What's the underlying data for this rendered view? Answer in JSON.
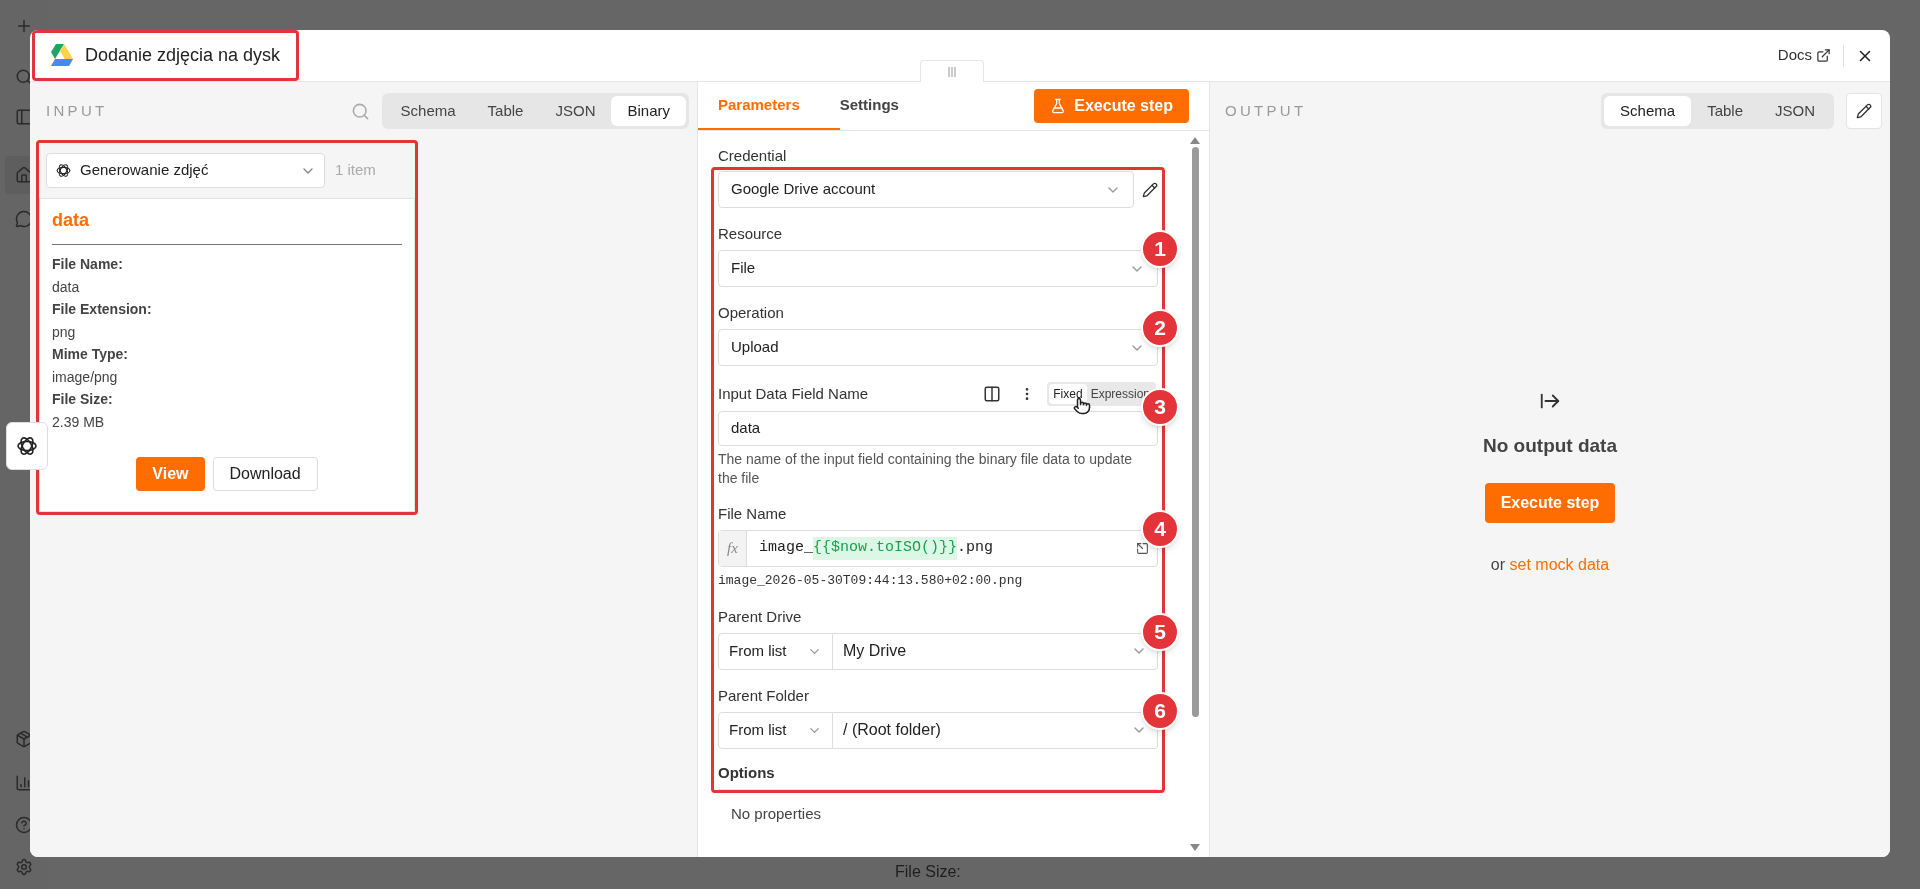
{
  "dialog": {
    "title": "Dodanie zdjęcia na dysk",
    "docs_link": "Docs"
  },
  "input_panel": {
    "heading": "INPUT",
    "tabs": [
      {
        "label": "Schema",
        "selected": false
      },
      {
        "label": "Table",
        "selected": false
      },
      {
        "label": "JSON",
        "selected": false
      },
      {
        "label": "Binary",
        "selected": true
      }
    ],
    "source": {
      "value": "Generowanie zdjęć",
      "count": "1 item"
    },
    "binary_card": {
      "title": "data",
      "fields": [
        {
          "label": "File Name:",
          "value": "data"
        },
        {
          "label": "File Extension:",
          "value": "png"
        },
        {
          "label": "Mime Type:",
          "value": "image/png"
        },
        {
          "label": "File Size:",
          "value": "2.39 MB"
        }
      ],
      "buttons": [
        {
          "label": "View",
          "kind": "primary"
        },
        {
          "label": "Download",
          "kind": "secondary"
        }
      ]
    }
  },
  "parameters_panel": {
    "tabs": [
      {
        "label": "Parameters",
        "selected": true
      },
      {
        "label": "Settings",
        "selected": false
      }
    ],
    "execute_button": "Execute step",
    "credential": {
      "label": "Credential",
      "value": "Google Drive account"
    },
    "fields": [
      {
        "kind": "select",
        "label": "Resource",
        "value": "File",
        "callout": "1"
      },
      {
        "kind": "select",
        "label": "Operation",
        "value": "Upload",
        "callout": "2"
      },
      {
        "kind": "text",
        "label": "Input Data Field Name",
        "value": "data",
        "modes": [
          {
            "label": "Fixed",
            "selected": true
          },
          {
            "label": "Expression",
            "selected": false
          }
        ],
        "hint": "The name of the input field containing the binary file data to update the file",
        "callout": "3"
      },
      {
        "kind": "expression",
        "label": "File Name",
        "prefix": "fx",
        "parts": [
          {
            "text": "image_",
            "kind": "plain"
          },
          {
            "text": "{{$now.toISO()}}",
            "kind": "resolved"
          },
          {
            "text": ".png",
            "kind": "plain"
          }
        ],
        "preview": "image_2026-05-30T09:44:13.580+02:00.png",
        "callout": "4"
      },
      {
        "kind": "locator",
        "label": "Parent Drive",
        "mode": "From list",
        "value": "My Drive",
        "callout": "5"
      },
      {
        "kind": "locator",
        "label": "Parent Folder",
        "mode": "From list",
        "value": "/ (Root folder)",
        "callout": "6"
      }
    ],
    "options": {
      "label": "Options",
      "empty_text": "No properties"
    }
  },
  "output_panel": {
    "heading": "OUTPUT",
    "tabs": [
      {
        "label": "Schema",
        "selected": true
      },
      {
        "label": "Table",
        "selected": false
      },
      {
        "label": "JSON",
        "selected": false
      }
    ],
    "empty_state": {
      "title": "No output data",
      "button": "Execute step",
      "prefix": "or",
      "link": "set mock data"
    }
  },
  "background": {
    "texts": [
      "File Size:"
    ]
  }
}
